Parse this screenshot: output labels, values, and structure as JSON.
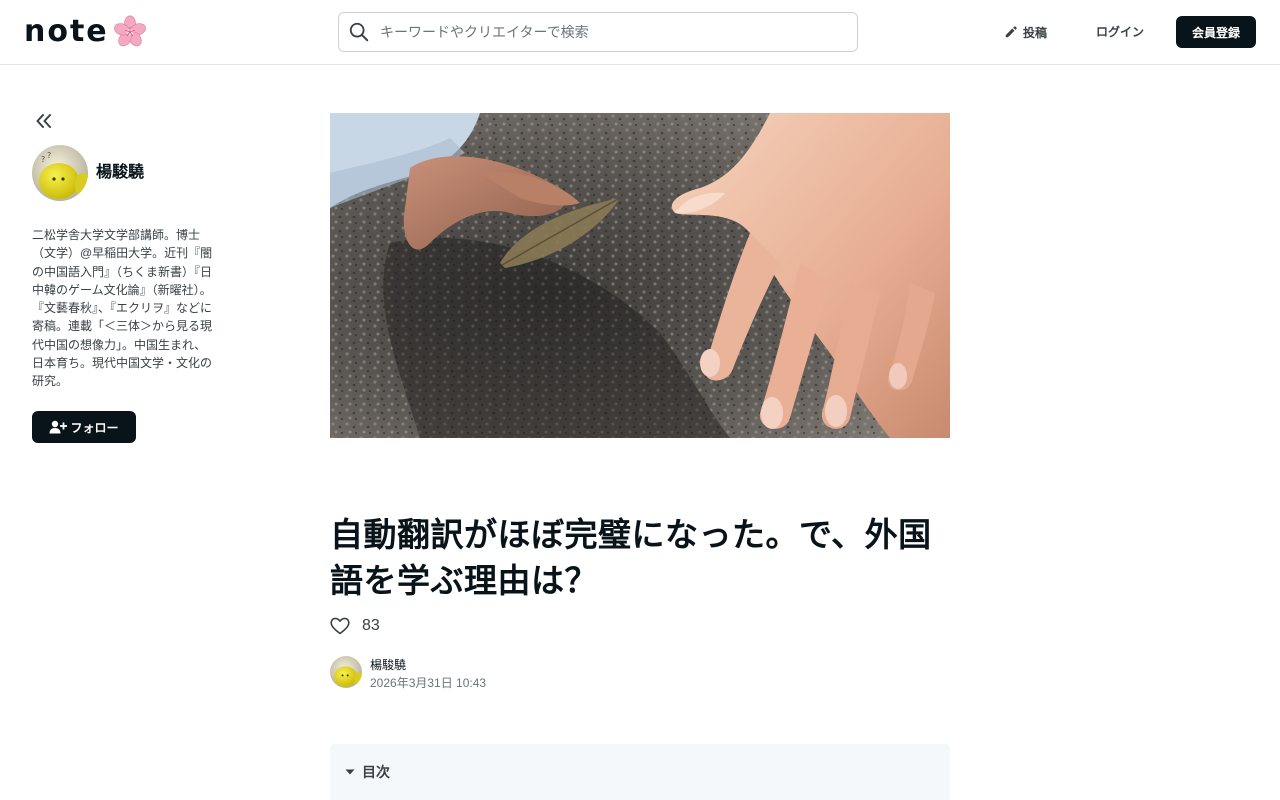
{
  "header": {
    "logo_text": "note",
    "search_placeholder": "キーワードやクリエイターで検索",
    "post_label": "投稿",
    "login_label": "ログイン",
    "signup_label": "会員登録"
  },
  "sidebar": {
    "creator_name": "楊駿驍",
    "bio": "二松学舎大学文学部講師。博士（文学）@早稲田大学。近刊『闇の中国語入門』（ちくま新書）『日中韓のゲーム文化論』（新曜社）。『文藝春秋』、『エクリヲ』などに寄稿。連載「＜三体＞から見る現代中国の想像力」。中国生まれ、日本育ち。現代中国文学・文化の研究。",
    "follow_label": "フォロー"
  },
  "article": {
    "title": "自動翻訳がほぼ完璧になった。で、外国語を学ぶ理由は？",
    "like_count": "83",
    "author_name": "楊駿驍",
    "published": "2026年3月31日 10:43",
    "toc_label": "目次"
  },
  "colors": {
    "primary_dark": "#08131a",
    "text_secondary": "#3a4145",
    "text_muted": "#6c7478",
    "border": "#e3e6e8",
    "toc_bg": "#f5f8fa",
    "logo_flower": "#f3a9c2"
  },
  "icons": {
    "logo_mark": "cherry-blossom-icon",
    "search": "search-icon",
    "post": "pencil-icon",
    "collapse": "double-chevron-left-icon",
    "follow": "user-plus-icon",
    "like": "heart-icon",
    "toc": "caret-down-icon"
  }
}
